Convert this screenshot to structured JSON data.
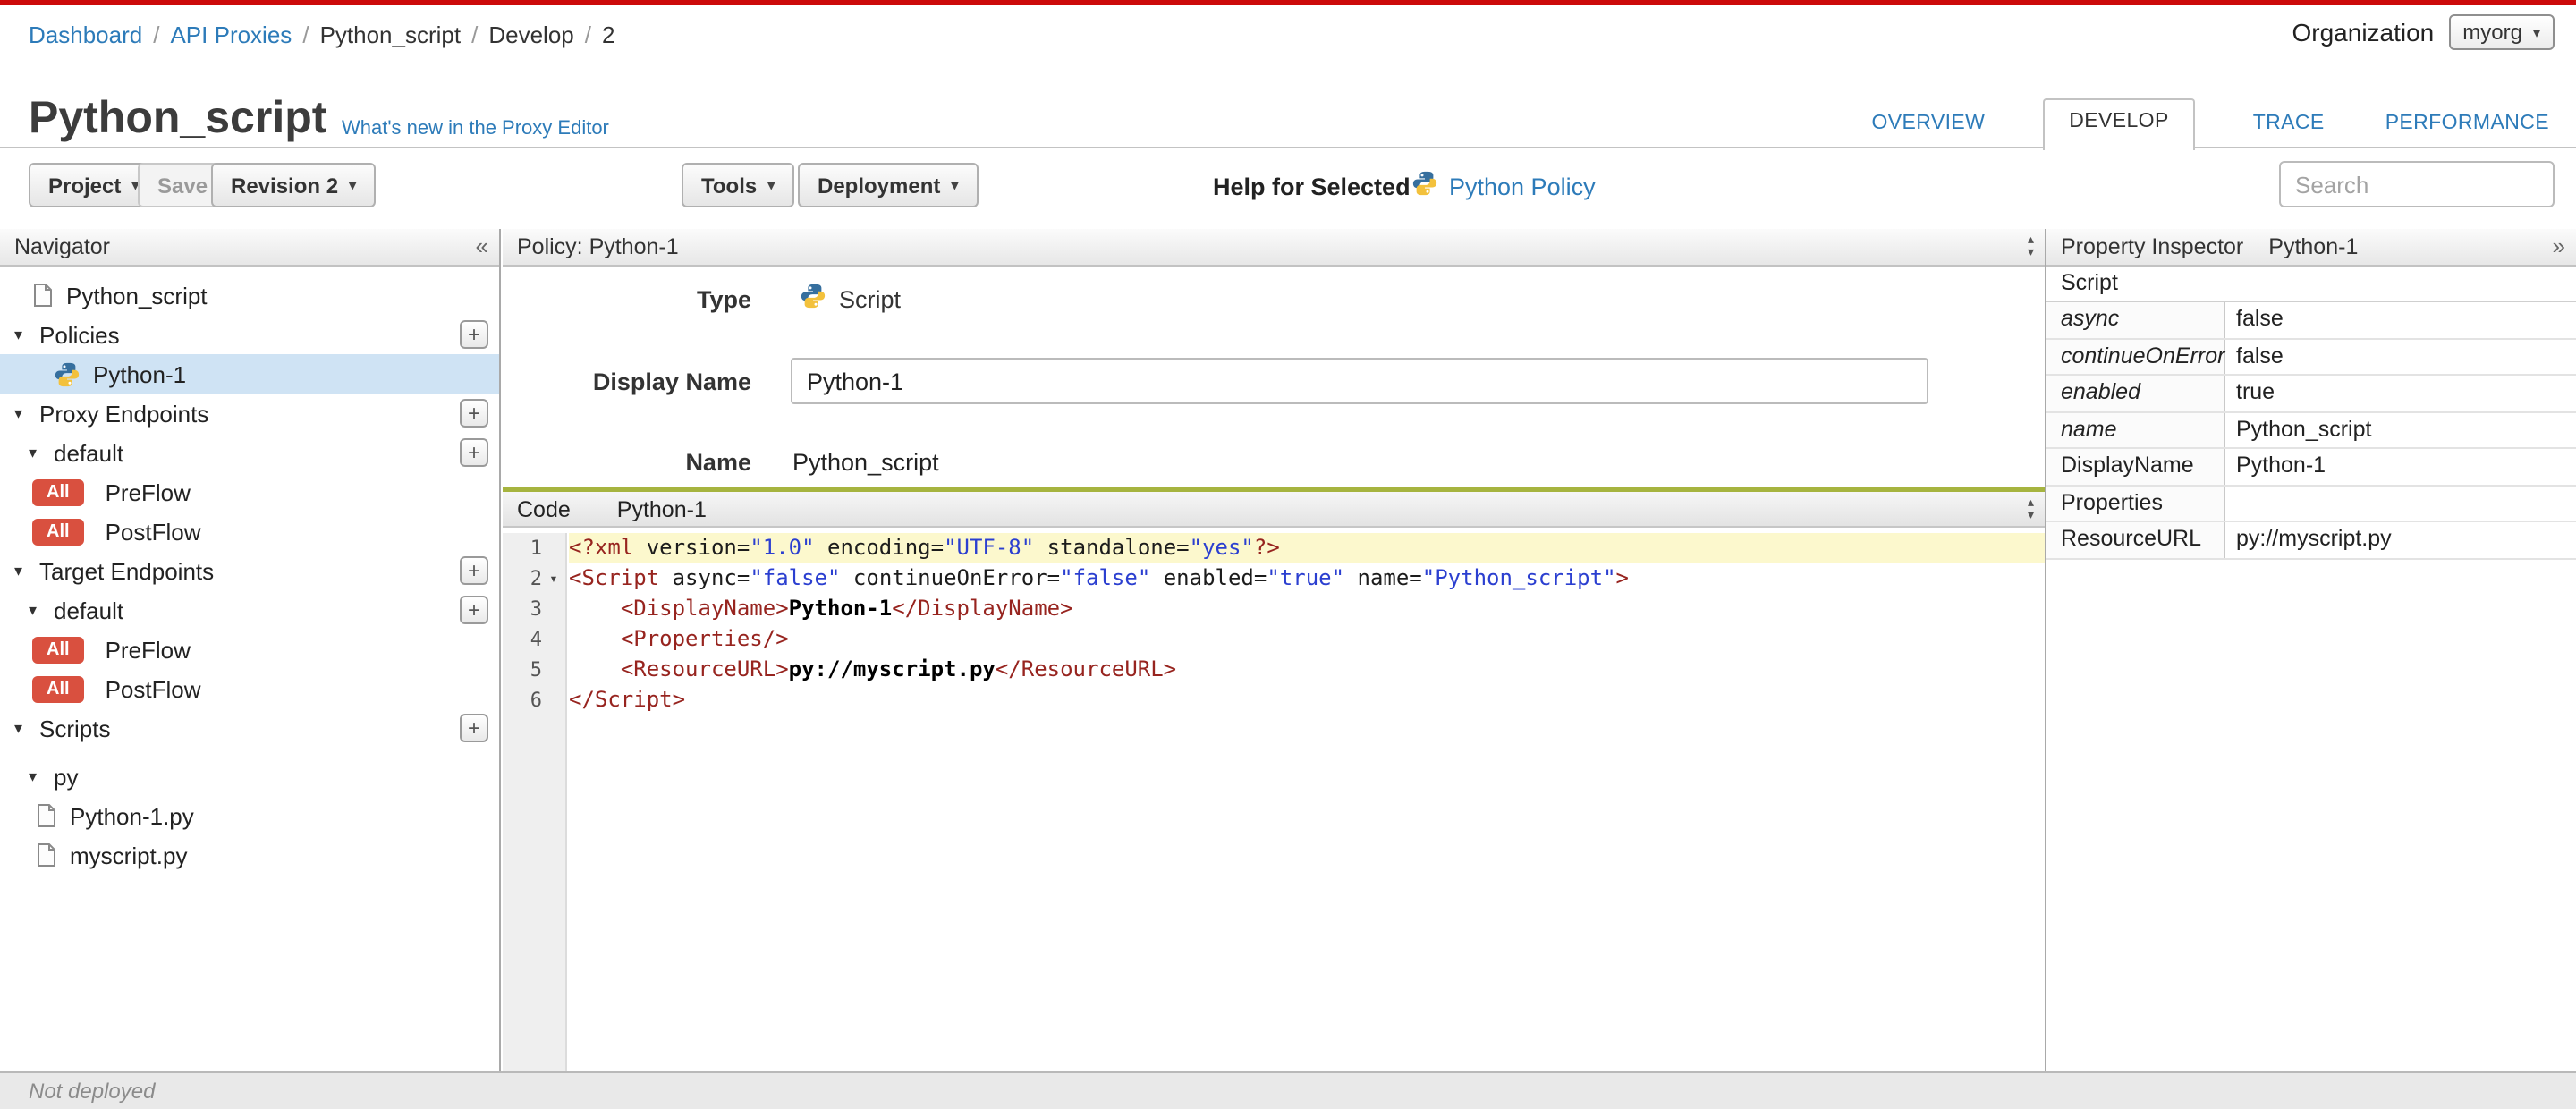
{
  "colors": {
    "top_bar_red": "#cc0a0a",
    "link_blue": "#2d7bb9",
    "badge_red": "#d9503f",
    "selected_row_blue": "#cfe3f4",
    "code_accent_green": "#a6b43f",
    "tag_token_red": "#97241f",
    "string_token_blue": "#2b3fd0",
    "line_highlight_yellow": "#fcf8cd"
  },
  "breadcrumb": {
    "separator": "/",
    "items": [
      {
        "label": "Dashboard",
        "link": true
      },
      {
        "label": "API Proxies",
        "link": true
      },
      {
        "label": "Python_script",
        "link": false
      },
      {
        "label": "Develop",
        "link": false
      },
      {
        "label": "2",
        "link": false
      }
    ]
  },
  "organization": {
    "label": "Organization",
    "value": "myorg"
  },
  "header": {
    "title": "Python_script",
    "whats_new": "What's new in the Proxy Editor"
  },
  "tabs": [
    {
      "label": "OVERVIEW",
      "active": false
    },
    {
      "label": "DEVELOP",
      "active": true
    },
    {
      "label": "TRACE",
      "active": false
    },
    {
      "label": "PERFORMANCE",
      "active": false
    }
  ],
  "toolbar": {
    "project": "Project",
    "save": "Save",
    "revision": "Revision 2",
    "tools": "Tools",
    "deployment": "Deployment",
    "help_for_selected": "Help for Selected",
    "policy_link": "Python Policy",
    "search_placeholder": "Search"
  },
  "navigator": {
    "title": "Navigator",
    "items": [
      {
        "kind": "file",
        "label": "Python_script",
        "icon": "file-icon"
      },
      {
        "kind": "section",
        "label": "Policies",
        "plus": true
      },
      {
        "kind": "policy",
        "label": "Python-1",
        "icon": "python-icon",
        "selected": true
      },
      {
        "kind": "section",
        "label": "Proxy Endpoints",
        "plus": true
      },
      {
        "kind": "sub",
        "label": "default",
        "plus": true
      },
      {
        "kind": "flow",
        "badge": "All",
        "label": "PreFlow"
      },
      {
        "kind": "flow",
        "badge": "All",
        "label": "PostFlow"
      },
      {
        "kind": "section",
        "label": "Target Endpoints",
        "plus": true
      },
      {
        "kind": "sub",
        "label": "default",
        "plus": true
      },
      {
        "kind": "flow",
        "badge": "All",
        "label": "PreFlow"
      },
      {
        "kind": "flow",
        "badge": "All",
        "label": "PostFlow"
      },
      {
        "kind": "section",
        "label": "Scripts",
        "plus": true
      },
      {
        "kind": "sub",
        "label": "py",
        "gap": true
      },
      {
        "kind": "file2",
        "label": "Python-1.py",
        "icon": "file-icon"
      },
      {
        "kind": "file2",
        "label": "myscript.py",
        "icon": "file-icon"
      }
    ]
  },
  "policy_panel": {
    "header": "Policy: Python-1",
    "type_label": "Type",
    "type_value": "Script",
    "display_name_label": "Display Name",
    "display_name_value": "Python-1",
    "name_label": "Name",
    "name_value": "Python_script"
  },
  "code_panel": {
    "tab_label": "Code",
    "policy_name": "Python-1",
    "lines": [
      {
        "no": 1,
        "highlight": true,
        "tokens": [
          [
            "tag",
            "<?xml"
          ],
          [
            "attr",
            " version="
          ],
          [
            "str",
            "\"1.0\""
          ],
          [
            "attr",
            " encoding="
          ],
          [
            "str",
            "\"UTF-8\""
          ],
          [
            "attr",
            " standalone="
          ],
          [
            "str",
            "\"yes\""
          ],
          [
            "tag",
            "?>"
          ]
        ]
      },
      {
        "no": 2,
        "fold": true,
        "tokens": [
          [
            "tag",
            "<Script"
          ],
          [
            "attr",
            " async="
          ],
          [
            "str",
            "\"false\""
          ],
          [
            "attr",
            " continueOnError="
          ],
          [
            "str",
            "\"false\""
          ],
          [
            "attr",
            " enabled="
          ],
          [
            "str",
            "\"true\""
          ],
          [
            "attr",
            " name="
          ],
          [
            "str",
            "\"Python_script\""
          ],
          [
            "tag",
            ">"
          ]
        ]
      },
      {
        "no": 3,
        "tokens": [
          [
            "plain",
            "    "
          ],
          [
            "tag",
            "<DisplayName>"
          ],
          [
            "txt",
            "Python-1"
          ],
          [
            "tag",
            "</DisplayName>"
          ]
        ]
      },
      {
        "no": 4,
        "tokens": [
          [
            "plain",
            "    "
          ],
          [
            "tag",
            "<Properties/>"
          ]
        ]
      },
      {
        "no": 5,
        "tokens": [
          [
            "plain",
            "    "
          ],
          [
            "tag",
            "<ResourceURL>"
          ],
          [
            "txt",
            "py://myscript.py"
          ],
          [
            "tag",
            "</ResourceURL>"
          ]
        ]
      },
      {
        "no": 6,
        "tokens": [
          [
            "tag",
            "</Script>"
          ]
        ]
      }
    ]
  },
  "inspector": {
    "title": "Property Inspector",
    "subtitle": "Python-1",
    "section": "Script",
    "rows": [
      {
        "label": "async",
        "value": "false",
        "italic": true
      },
      {
        "label": "continueOnError",
        "value": "false",
        "italic": true
      },
      {
        "label": "enabled",
        "value": "true",
        "italic": true
      },
      {
        "label": "name",
        "value": "Python_script",
        "italic": true
      },
      {
        "label": "DisplayName",
        "value": "Python-1",
        "italic": false
      },
      {
        "label": "Properties",
        "value": "",
        "italic": false
      },
      {
        "label": "ResourceURL",
        "value": "py://myscript.py",
        "italic": false
      }
    ]
  },
  "status_bar": {
    "text": "Not deployed"
  }
}
